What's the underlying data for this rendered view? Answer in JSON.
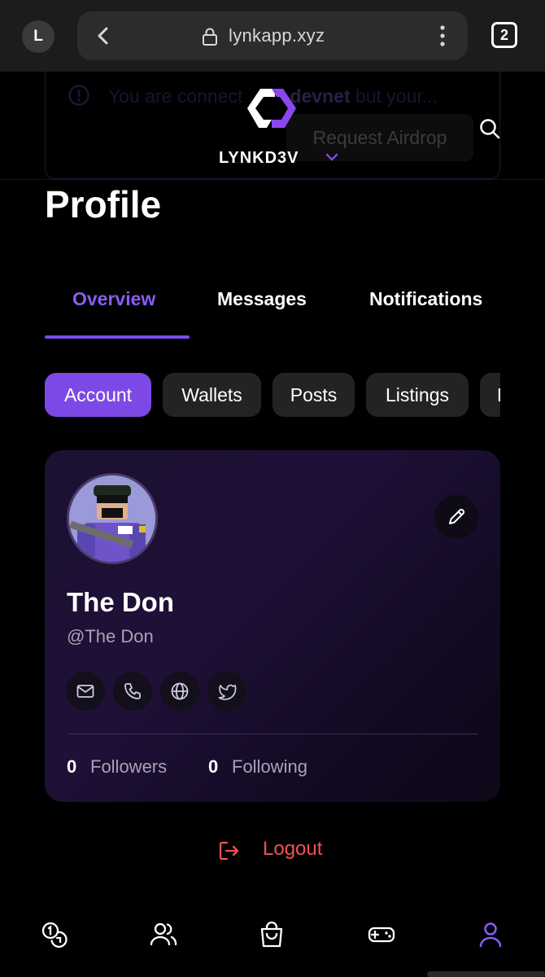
{
  "browser": {
    "profile_initial": "L",
    "url": "lynkapp.xyz",
    "tab_count": "2"
  },
  "banner": {
    "message_start": "You are connect",
    "network": "devnet",
    "message_end": " but your...",
    "airdrop_label": "Request Airdrop"
  },
  "header": {
    "brand": "LYNKD3V"
  },
  "page": {
    "title": "Profile"
  },
  "tabs": [
    {
      "label": "Overview",
      "active": true
    },
    {
      "label": "Messages",
      "active": false
    },
    {
      "label": "Notifications",
      "active": false
    }
  ],
  "chips": [
    {
      "label": "Account",
      "active": true
    },
    {
      "label": "Wallets",
      "active": false
    },
    {
      "label": "Posts",
      "active": false
    },
    {
      "label": "Listings",
      "active": false
    },
    {
      "label": "L",
      "active": false
    }
  ],
  "profile": {
    "name": "The Don",
    "handle": "@The Don",
    "followers_count": "0",
    "followers_label": "Followers",
    "following_count": "0",
    "following_label": "Following",
    "social_icons": [
      "mail-icon",
      "phone-icon",
      "globe-icon",
      "twitter-icon"
    ]
  },
  "logout": {
    "label": "Logout"
  },
  "bottom_nav": {
    "items": [
      "coins-icon",
      "users-icon",
      "shopping-bag-icon",
      "gamepad-icon",
      "user-icon"
    ],
    "active": "user-icon"
  },
  "colors": {
    "accent": "#7d49e6",
    "accent_text": "#8a5cf6",
    "logout": "#f05252",
    "background": "#000000"
  }
}
